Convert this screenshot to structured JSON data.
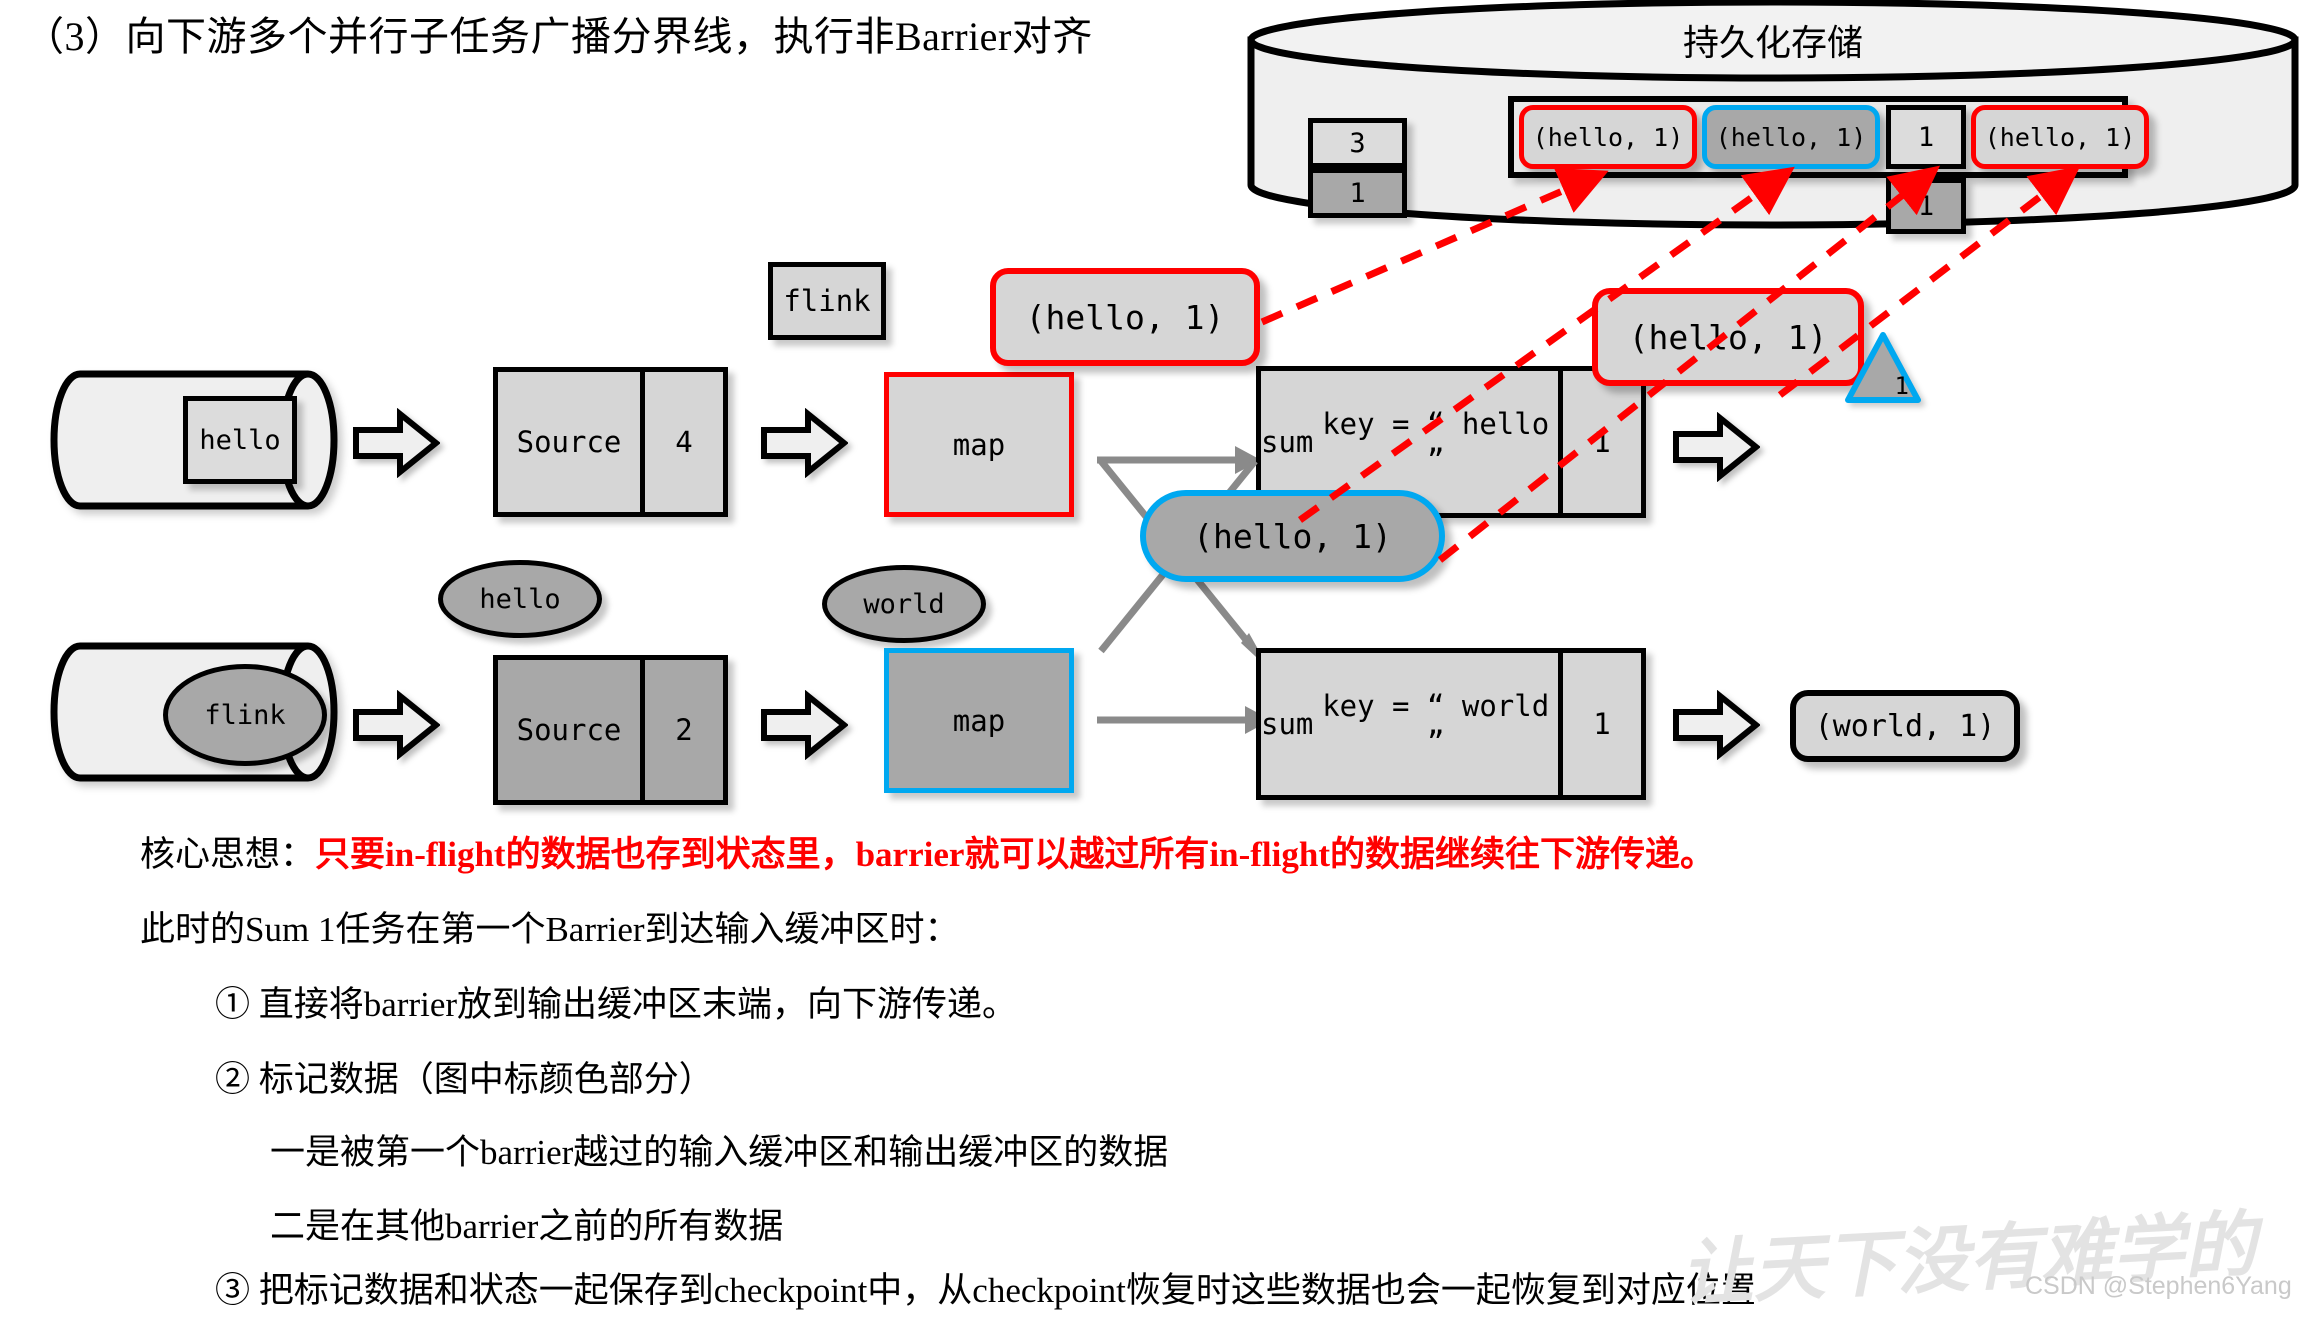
{
  "title": "（3）向下游多个并行子任务广播分界线，执行非Barrier对齐",
  "storage": {
    "label": "持久化存储",
    "state_cells": [
      {
        "value": "3",
        "tone": "light"
      },
      {
        "value": "1",
        "tone": "dark"
      }
    ],
    "buffer_cells": [
      {
        "value": "(hello, 1)",
        "tone": "light",
        "outline": "red"
      },
      {
        "value": "(hello, 1)",
        "tone": "dark",
        "outline": "blue"
      },
      {
        "value": "1",
        "tone": "light",
        "outline": "black"
      },
      {
        "value": "(hello, 1)",
        "tone": "light",
        "outline": "red"
      }
    ],
    "pending_cell": {
      "value": "1",
      "tone": "dark"
    }
  },
  "pipeline": {
    "row1": {
      "stream_record": "hello",
      "source_label": "Source",
      "source_count": "4",
      "map_label": "map",
      "sum_label_line1": "sum",
      "sum_label_line2": "key = “ hello ”",
      "sum_count": "1"
    },
    "row2": {
      "stream_record": "flink",
      "source_label": "Source",
      "source_count": "2",
      "map_label": "map",
      "sum_label_line1": "sum",
      "sum_label_line2": "key = “ world ”",
      "sum_count": "1",
      "output_tuple": "(world, 1)"
    }
  },
  "floating": {
    "flink_box": "flink",
    "hello_ellipse": "hello",
    "world_ellipse": "world",
    "tuple_after_map": "(hello, 1)",
    "tuple_in_flight": "(hello, 1)",
    "tuple_after_sum": "(hello, 1)",
    "barrier_marker": "1"
  },
  "notes": {
    "core_label": "核心思想：",
    "core_text": "只要in-flight的数据也存到状态里，barrier就可以越过所有in-flight的数据继续往下游传递。",
    "line_when": "此时的Sum 1任务在第一个Barrier到达输入缓冲区时：",
    "item1": "① 直接将barrier放到输出缓冲区末端，向下游传递。",
    "item2": "② 标记数据（图中标颜色部分）",
    "item2a": "一是被第一个barrier越过的输入缓冲区和输出缓冲区的数据",
    "item2b": "二是在其他barrier之前的所有数据",
    "item3": "③ 把标记数据和状态一起保存到checkpoint中，从checkpoint恢复时这些数据也会一起恢复到对应位置"
  },
  "watermark": {
    "text": "让天下没有难学的",
    "credit": "CSDN @Stephen6Yang"
  },
  "colors": {
    "red": "#ff0000",
    "blue": "#00a8f0",
    "gray_dark": "#a8a8a8",
    "gray_light": "#d6d6d6",
    "black": "#000000"
  }
}
